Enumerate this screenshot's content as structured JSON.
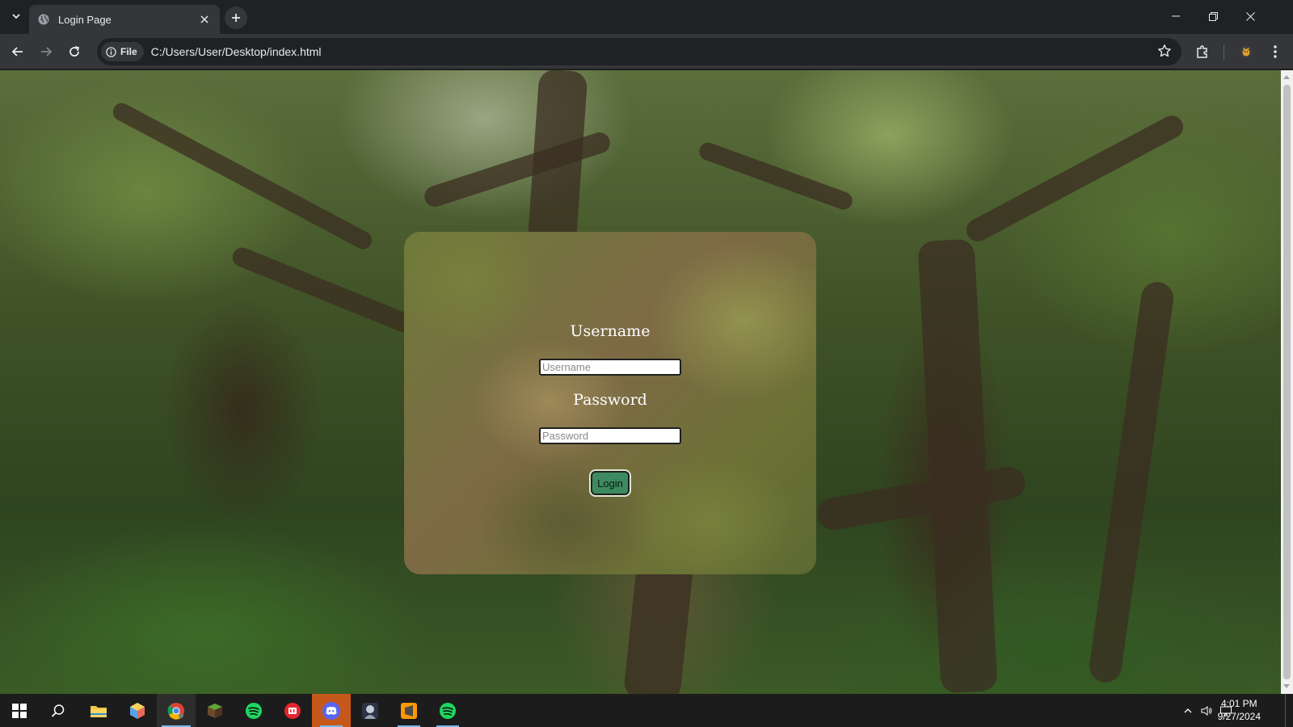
{
  "browser": {
    "tab_title": "Login Page",
    "address_chip": "File",
    "url": "C:/Users/User/Desktop/index.html"
  },
  "login": {
    "username_label": "Username",
    "username_placeholder": "Username",
    "password_label": "Password",
    "password_placeholder": "Password",
    "login_button": "Login"
  },
  "taskbar": {
    "apps": [
      "start-icon",
      "search-icon",
      "file-explorer-icon",
      "cube-app-icon",
      "chrome-icon",
      "minecraft-icon",
      "spotify-icon",
      "red-app-icon",
      "discord-icon",
      "game-icon",
      "sublime-text-icon",
      "spotify-icon"
    ],
    "time": "4:01 PM",
    "date": "9/27/2024"
  },
  "colors": {
    "card_button": "#3d8a60",
    "chrome_dark": "#202124",
    "accent": "#76b9ed"
  }
}
